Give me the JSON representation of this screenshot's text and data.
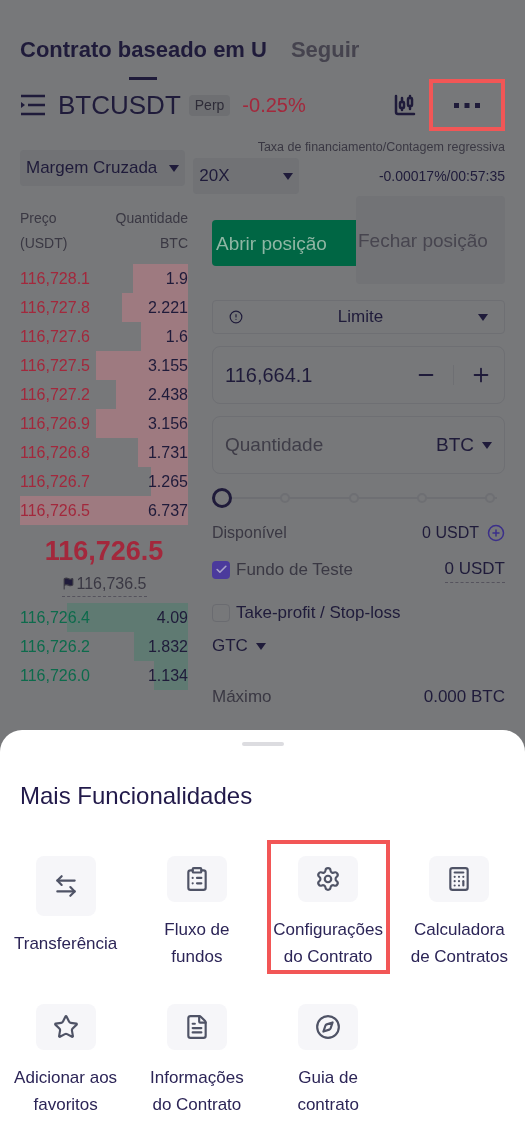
{
  "tabs": [
    {
      "label": "Contrato baseado em U",
      "selected": true
    },
    {
      "label": "Seguir",
      "selected": false
    }
  ],
  "ticker": {
    "symbol": "BTCUSDT",
    "badge": "Perp",
    "change": "-0.25%",
    "more_highlighted": true
  },
  "margin_mode": "Margem Cruzada",
  "leverage": "20X",
  "funding": {
    "label": "Taxa de financiamento/Contagem regressiva",
    "value": "-0.00017%/00:57:35"
  },
  "orderbook": {
    "price_header": "Preço",
    "price_unit": "(USDT)",
    "qty_header": "Quantidade",
    "qty_unit": "BTC",
    "asks": [
      {
        "price": "116,728.1",
        "qty": "1.9"
      },
      {
        "price": "116,727.8",
        "qty": "2.221"
      },
      {
        "price": "116,727.6",
        "qty": "1.6"
      },
      {
        "price": "116,727.5",
        "qty": "3.155"
      },
      {
        "price": "116,727.2",
        "qty": "2.438"
      },
      {
        "price": "116,726.9",
        "qty": "3.156"
      },
      {
        "price": "116,726.8",
        "qty": "1.731"
      },
      {
        "price": "116,726.7",
        "qty": "1.265"
      },
      {
        "price": "116,726.5",
        "qty": "6.737"
      }
    ],
    "last_price": "116,726.5",
    "mark_price": "116,736.5",
    "bids": [
      {
        "price": "116,726.4",
        "qty": "4.09"
      },
      {
        "price": "116,726.2",
        "qty": "1.832"
      },
      {
        "price": "116,726.0",
        "qty": "1.134"
      }
    ]
  },
  "order_tabs": [
    {
      "label": "Abrir posição",
      "selected": true
    },
    {
      "label": "Fechar posição",
      "selected": false
    }
  ],
  "order_type": "Limite",
  "price": "116,664.1",
  "quantity": {
    "placeholder": "Quantidade",
    "unit": "BTC"
  },
  "slider": {
    "level": 0
  },
  "available": {
    "label": "Disponível",
    "value": "0 USDT"
  },
  "options": [
    {
      "label": "Fundo de Teste",
      "checked": true,
      "value": "0 USDT"
    },
    {
      "label": "Take-profit / Stop-loss",
      "checked": false
    }
  ],
  "time_in_force": "GTC",
  "max": {
    "label": "Máximo",
    "value": "0.000 BTC"
  },
  "sheet": {
    "title": "Mais Funcionalidades",
    "items": [
      {
        "label": "Transferência",
        "highlighted": false
      },
      {
        "label": "Fluxo de fundos",
        "highlighted": false
      },
      {
        "label": "Configurações do Contrato",
        "highlighted": true
      },
      {
        "label": "Calculadora de Contratos",
        "highlighted": false
      },
      {
        "label": "Adicionar aos favoritos",
        "highlighted": false
      },
      {
        "label": "Informações do Contrato",
        "highlighted": false
      },
      {
        "label": "Guia de contrato",
        "highlighted": false
      }
    ]
  }
}
